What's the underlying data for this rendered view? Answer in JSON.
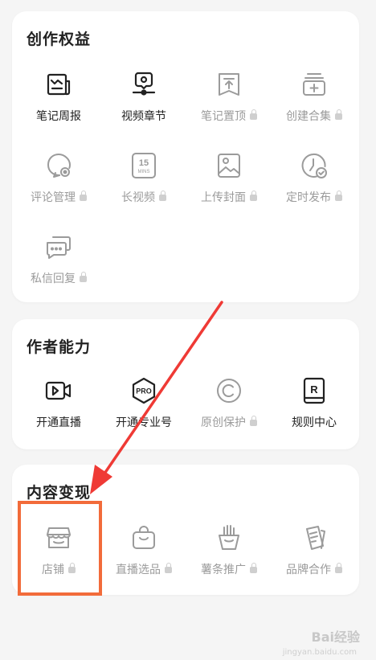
{
  "sections": {
    "creation": {
      "title": "创作权益",
      "items": [
        {
          "label": "笔记周报",
          "icon": "weekly-report-icon",
          "locked": false
        },
        {
          "label": "视频章节",
          "icon": "video-chapter-icon",
          "locked": false
        },
        {
          "label": "笔记置顶",
          "icon": "pin-note-icon",
          "locked": true
        },
        {
          "label": "创建合集",
          "icon": "create-collection-icon",
          "locked": true
        },
        {
          "label": "评论管理",
          "icon": "comment-manage-icon",
          "locked": true
        },
        {
          "label": "长视频",
          "icon": "long-video-icon",
          "locked": true
        },
        {
          "label": "上传封面",
          "icon": "upload-cover-icon",
          "locked": true
        },
        {
          "label": "定时发布",
          "icon": "scheduled-publish-icon",
          "locked": true
        },
        {
          "label": "私信回复",
          "icon": "dm-reply-icon",
          "locked": true
        }
      ]
    },
    "author": {
      "title": "作者能力",
      "items": [
        {
          "label": "开通直播",
          "icon": "live-icon",
          "locked": false
        },
        {
          "label": "开通专业号",
          "icon": "pro-account-icon",
          "locked": false
        },
        {
          "label": "原创保护",
          "icon": "copyright-icon",
          "locked": true
        },
        {
          "label": "规则中心",
          "icon": "rules-center-icon",
          "locked": false
        }
      ]
    },
    "monetize": {
      "title": "内容变现",
      "items": [
        {
          "label": "店铺",
          "icon": "shop-icon",
          "locked": true
        },
        {
          "label": "直播选品",
          "icon": "shopping-bag-icon",
          "locked": true
        },
        {
          "label": "薯条推广",
          "icon": "fries-promo-icon",
          "locked": true
        },
        {
          "label": "品牌合作",
          "icon": "brand-coop-icon",
          "locked": true
        }
      ]
    }
  },
  "long_video_icon_text": {
    "num": "15",
    "unit": "MINS"
  },
  "pro_icon_text": "PRO",
  "rules_icon_text": "R",
  "watermark": "Bai经验",
  "watermark_sub": "jingyan.baidu.com",
  "colors": {
    "accent": "#f26b3a",
    "icon_active": "#222222",
    "icon_disabled": "#9b9b9b"
  }
}
